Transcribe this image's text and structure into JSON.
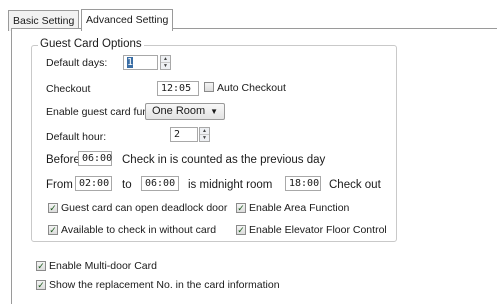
{
  "tabs": [
    {
      "label": "Basic Setting"
    },
    {
      "label": "Advanced Setting",
      "active": true
    }
  ],
  "group": {
    "title": "Guest Card Options"
  },
  "default_days": {
    "label": "Default days:",
    "value": "1"
  },
  "checkout": {
    "label": "Checkout",
    "value": "12:05"
  },
  "auto_checkout": {
    "label": "Auto Checkout",
    "checked": false
  },
  "guest_card_function": {
    "label": "Enable guest card function",
    "selected": "One Room"
  },
  "default_hour": {
    "label": "Default hour:",
    "value": "2"
  },
  "before": {
    "label_before": "Before",
    "value": "06:00",
    "label_after": "Check in is counted as the previous day"
  },
  "midnight": {
    "label_from": "From",
    "from_value": "02:00",
    "label_to": "to",
    "to_value": "06:00",
    "label_room": "is midnight room",
    "checkout_value": "18:00",
    "label_checkout": "Check out"
  },
  "options": {
    "deadlock": {
      "label": "Guest card can open deadlock door",
      "checked": true
    },
    "area_function": {
      "label": "Enable Area Function",
      "checked": true
    },
    "without_card": {
      "label": "Available to check in without card",
      "checked": true
    },
    "elevator": {
      "label": "Enable Elevator Floor Control",
      "checked": true
    }
  },
  "multi_door": {
    "label": "Enable  Multi-door Card",
    "checked": true
  },
  "replacement_no": {
    "label": "Show the replacement No. in the card information",
    "checked": true
  }
}
